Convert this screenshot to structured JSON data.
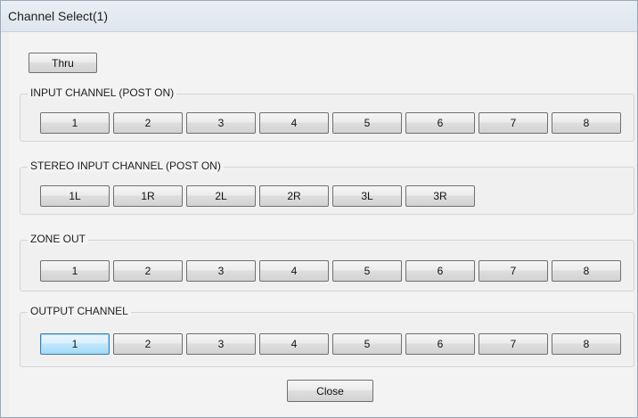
{
  "window": {
    "title": "Channel Select(1)"
  },
  "thru_label": "Thru",
  "groups": {
    "input": {
      "label": "INPUT CHANNEL (POST ON)",
      "buttons": [
        "1",
        "2",
        "3",
        "4",
        "5",
        "6",
        "7",
        "8"
      ]
    },
    "stereo": {
      "label": "STEREO INPUT CHANNEL (POST ON)",
      "buttons": [
        "1L",
        "1R",
        "2L",
        "2R",
        "3L",
        "3R"
      ]
    },
    "zone": {
      "label": "ZONE OUT",
      "buttons": [
        "1",
        "2",
        "3",
        "4",
        "5",
        "6",
        "7",
        "8"
      ]
    },
    "output": {
      "label": "OUTPUT CHANNEL",
      "buttons": [
        "1",
        "2",
        "3",
        "4",
        "5",
        "6",
        "7",
        "8"
      ],
      "selected": "1"
    }
  },
  "close_label": "Close"
}
